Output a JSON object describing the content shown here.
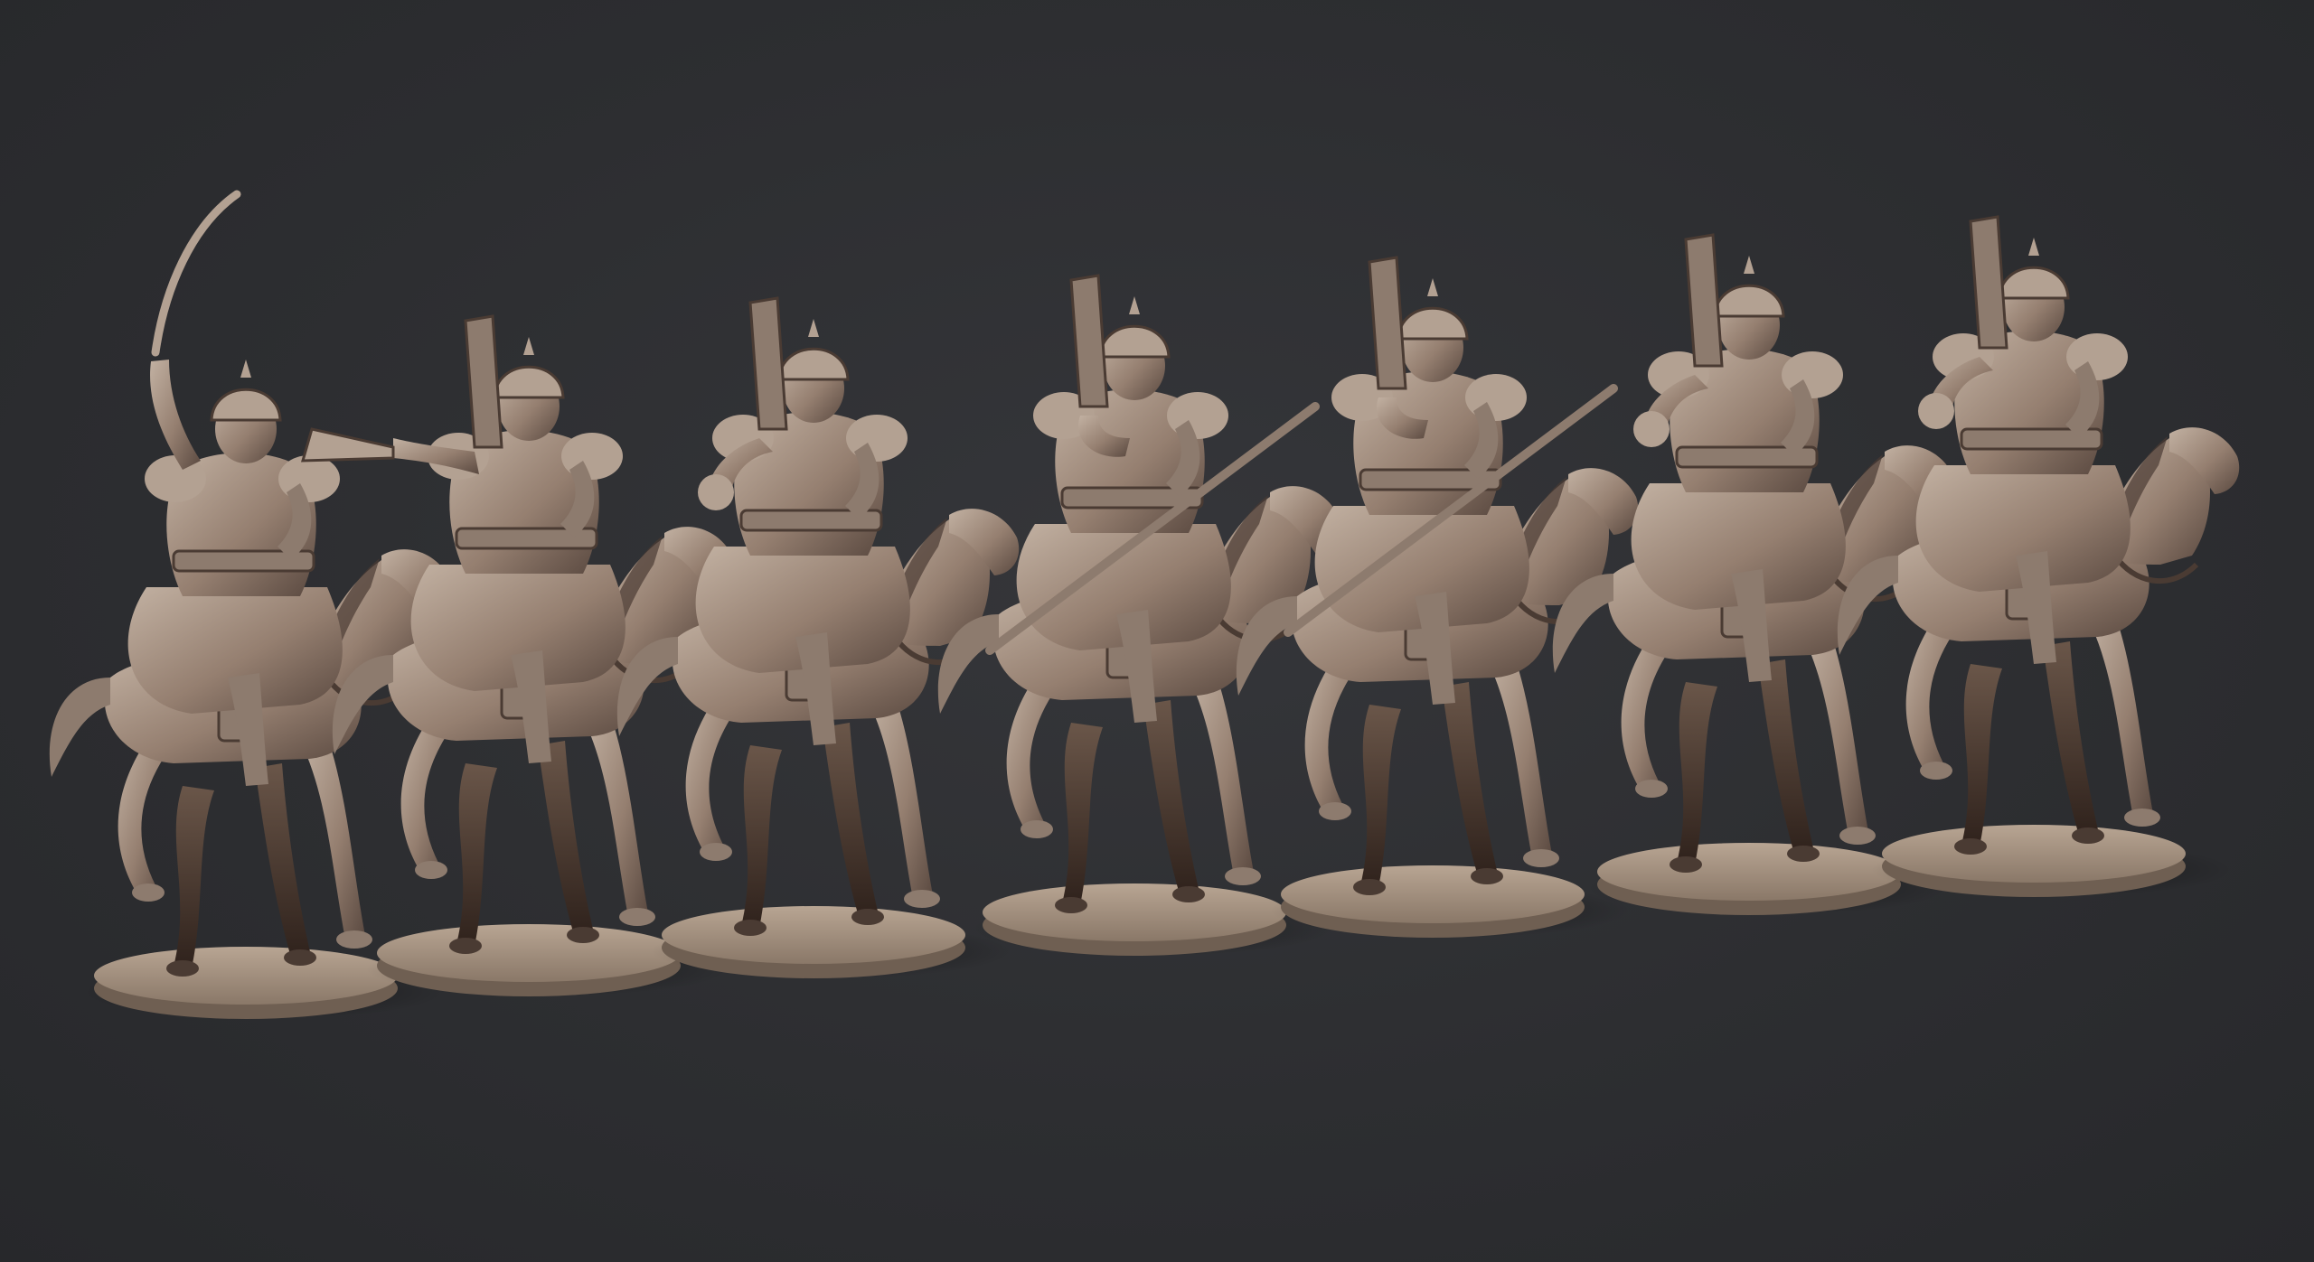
{
  "scene": {
    "colors": {
      "background": "#2e2f32",
      "clay_light": "#b3a192",
      "clay_mid": "#8d7b6e",
      "clay_dark": "#4a3b33",
      "horse_shadow": "#2a1c17",
      "base_top": "#a5937f",
      "base_side": "#6f5f52"
    },
    "miniatures": [
      {
        "pose": "raised-sabre",
        "weapon": "sabre",
        "scale": 1.0
      },
      {
        "pose": "horn-blower",
        "weapon": "horn",
        "scale": 1.0
      },
      {
        "pose": "charging",
        "weapon": "fist",
        "scale": 1.0
      },
      {
        "pose": "charging",
        "weapon": "lance",
        "scale": 1.0
      },
      {
        "pose": "charging",
        "weapon": "lance",
        "scale": 1.0
      },
      {
        "pose": "charging",
        "weapon": "fist",
        "scale": 1.0
      },
      {
        "pose": "charging",
        "weapon": "fist",
        "scale": 1.0
      }
    ]
  }
}
